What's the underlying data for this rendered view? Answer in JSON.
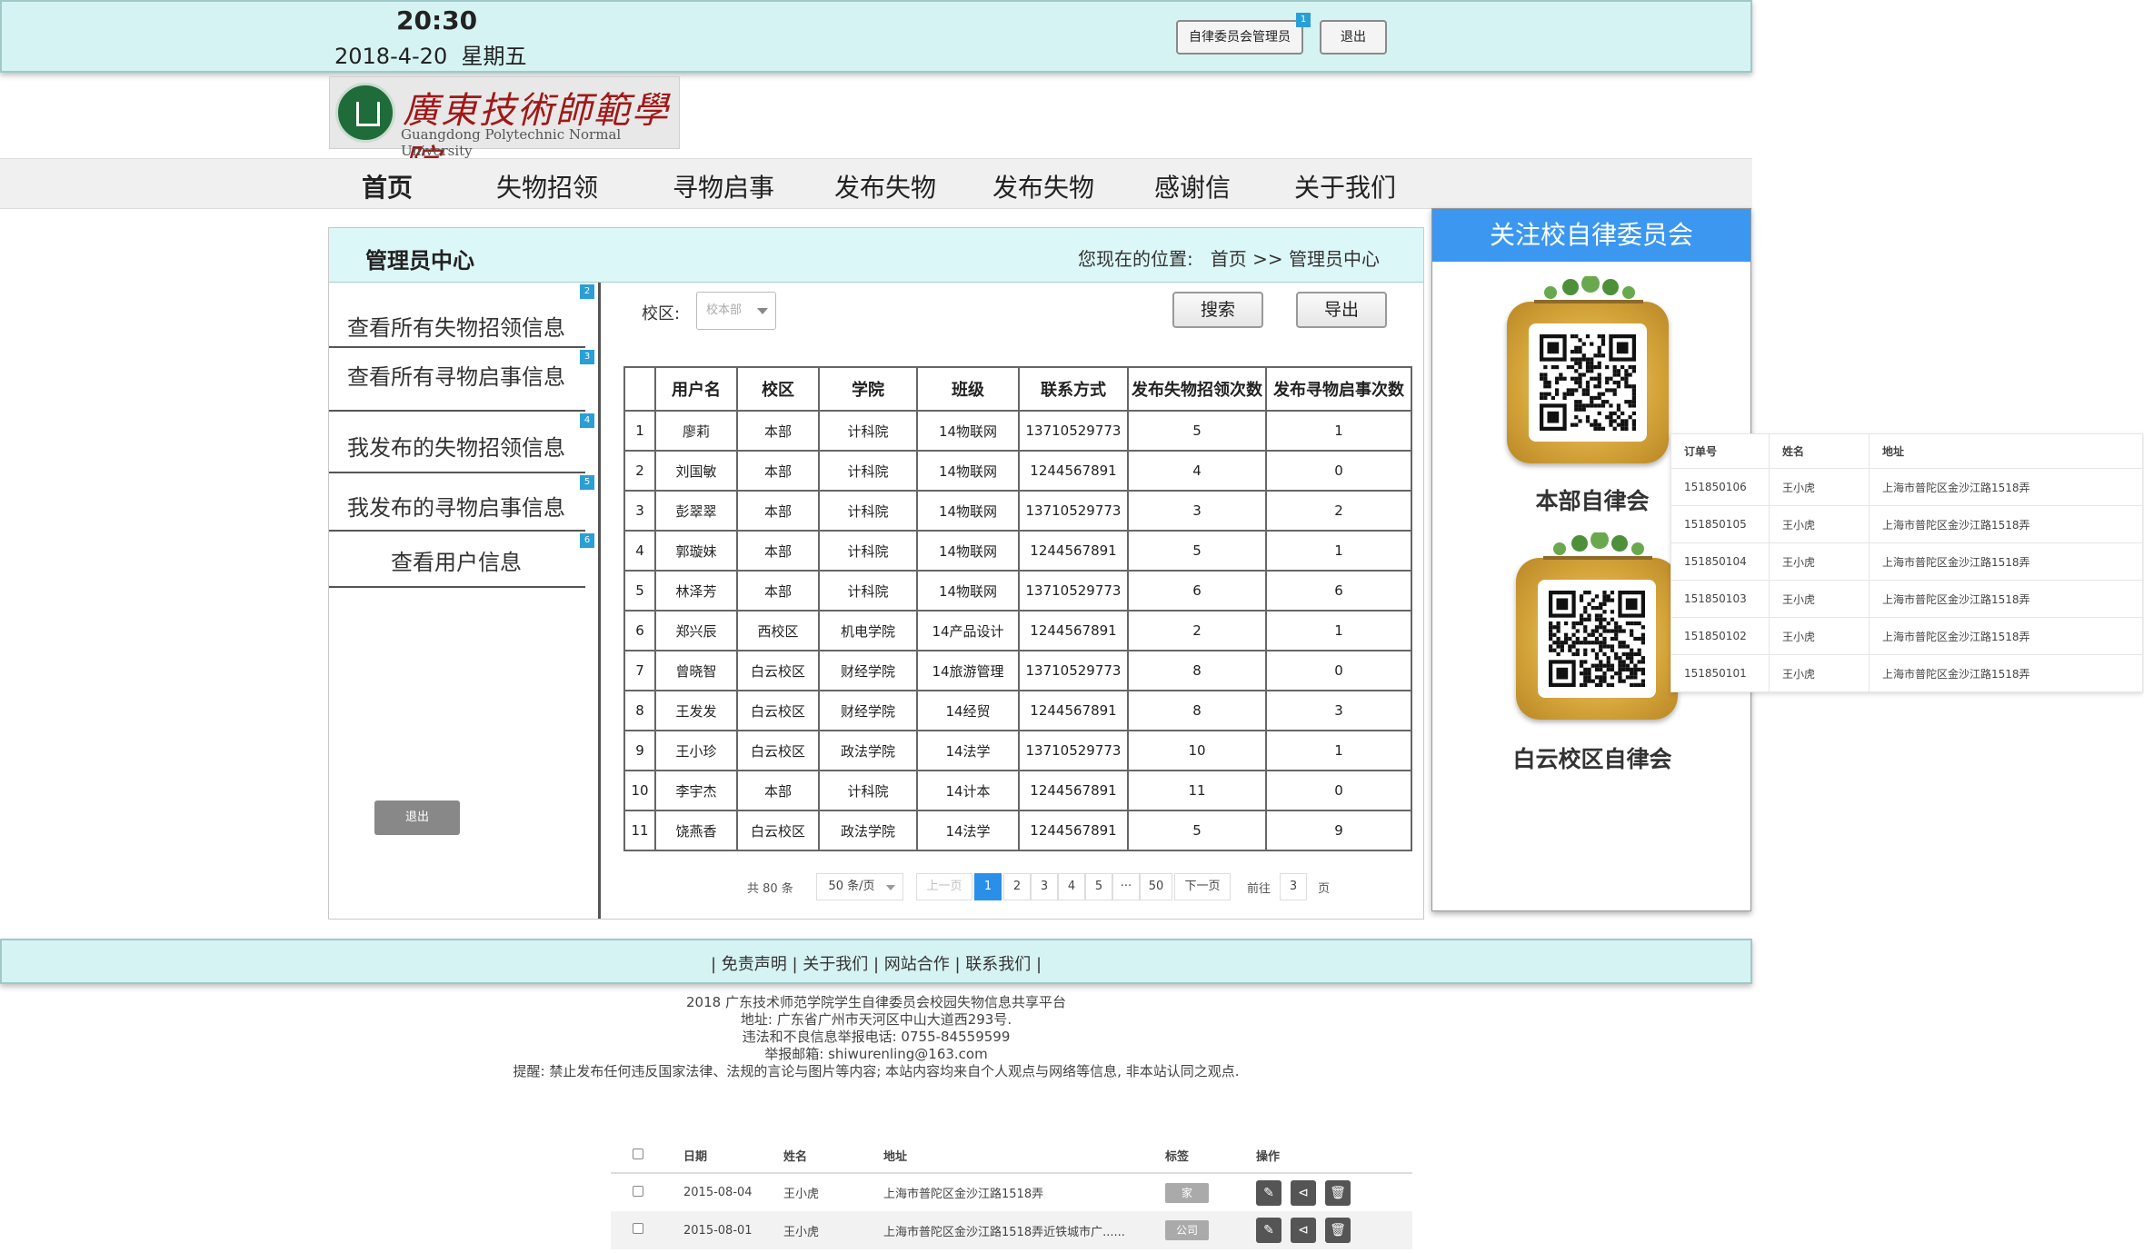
{
  "topbar": {
    "time": "20:30",
    "date": "2018-4-20  星期五",
    "admin_button": "自律委员会管理员",
    "admin_badge": "1",
    "logout_button": "退出"
  },
  "logo": {
    "cn": "廣東技術師範學院",
    "en": "Guangdong Polytechnic Normal University"
  },
  "nav": {
    "items": [
      "首页",
      "失物招领",
      "寻物启事",
      "发布失物",
      "发布失物",
      "感谢信",
      "关于我们"
    ]
  },
  "main": {
    "title": "管理员中心",
    "breadcrumb": "您现在的位置:   首页 >> 管理员中心",
    "side_menu": [
      {
        "label": "查看所有失物招领信息",
        "badge": "2"
      },
      {
        "label": "查看所有寻物启事信息",
        "badge": "3"
      },
      {
        "label": "我发布的失物招领信息",
        "badge": "4"
      },
      {
        "label": "我发布的寻物启事信息",
        "badge": "5"
      },
      {
        "label": "查看用户信息",
        "badge": "6"
      }
    ],
    "side_logout": "退出",
    "campus_label": "校区:",
    "campus_value": "校本部",
    "search_button": "搜索",
    "export_button": "导出",
    "table": {
      "headers": [
        "",
        "用户名",
        "校区",
        "学院",
        "班级",
        "联系方式",
        "发布失物招领次数",
        "发布寻物启事次数"
      ],
      "rows": [
        [
          "1",
          "廖莉",
          "本部",
          "计科院",
          "14物联网",
          "13710529773",
          "5",
          "1"
        ],
        [
          "2",
          "刘国敏",
          "本部",
          "计科院",
          "14物联网",
          "1244567891",
          "4",
          "0"
        ],
        [
          "3",
          "彭翠翠",
          "本部",
          "计科院",
          "14物联网",
          "13710529773",
          "3",
          "2"
        ],
        [
          "4",
          "郭璇妹",
          "本部",
          "计科院",
          "14物联网",
          "1244567891",
          "5",
          "1"
        ],
        [
          "5",
          "林泽芳",
          "本部",
          "计科院",
          "14物联网",
          "13710529773",
          "6",
          "6"
        ],
        [
          "6",
          "郑兴辰",
          "西校区",
          "机电学院",
          "14产品设计",
          "1244567891",
          "2",
          "1"
        ],
        [
          "7",
          "曾晓智",
          "白云校区",
          "财经学院",
          "14旅游管理",
          "13710529773",
          "8",
          "0"
        ],
        [
          "8",
          "王发发",
          "白云校区",
          "财经学院",
          "14经贸",
          "1244567891",
          "8",
          "3"
        ],
        [
          "9",
          "王小珍",
          "白云校区",
          "政法学院",
          "14法学",
          "13710529773",
          "10",
          "1"
        ],
        [
          "10",
          "李宇杰",
          "本部",
          "计科院",
          "14计本",
          "1244567891",
          "11",
          "0"
        ],
        [
          "11",
          "饶燕香",
          "白云校区",
          "政法学院",
          "14法学",
          "1244567891",
          "5",
          "9"
        ]
      ]
    },
    "pager": {
      "total": "共 80 条",
      "per_page": "50 条/页",
      "prev": "上一页",
      "pages": [
        "1",
        "2",
        "3",
        "4",
        "5",
        "···",
        "50"
      ],
      "next": "下一页",
      "goto_prefix": "前往",
      "goto_value": "3",
      "goto_suffix": "页"
    }
  },
  "right": {
    "title": "关注校自律委员会",
    "qr1_label": "本部自律会",
    "qr2_label": "白云校区自律会"
  },
  "order_table": {
    "headers": [
      "订单号",
      "姓名",
      "地址"
    ],
    "rows": [
      [
        "151850106",
        "王小虎",
        "上海市普陀区金沙江路1518弄"
      ],
      [
        "151850105",
        "王小虎",
        "上海市普陀区金沙江路1518弄"
      ],
      [
        "151850104",
        "王小虎",
        "上海市普陀区金沙江路1518弄"
      ],
      [
        "151850103",
        "王小虎",
        "上海市普陀区金沙江路1518弄"
      ],
      [
        "151850102",
        "王小虎",
        "上海市普陀区金沙江路1518弄"
      ],
      [
        "151850101",
        "王小虎",
        "上海市普陀区金沙江路1518弄"
      ]
    ]
  },
  "footer": {
    "links": "| 免责声明 | 关于我们 | 网站合作 | 联系我们 |",
    "lines": [
      "2018 广东技术师范学院学生自律委员会校园失物信息共享平台",
      "地址:  广东省广州市天河区中山大道西293号.",
      "违法和不良信息举报电话:  0755-84559599",
      "举报邮箱:  shiwurenling@163.com",
      "提醒:  禁止发布任何违反国家法律、法规的言论与图片等内容;  本站内容均来自个人观点与网络等信息,  非本站认同之观点."
    ]
  },
  "bottom_table": {
    "headers": [
      "",
      "日期",
      "姓名",
      "地址",
      "标签",
      "操作"
    ],
    "rows": [
      [
        "2015-08-04",
        "王小虎",
        "上海市普陀区金沙江路1518弄",
        "家"
      ],
      [
        "2015-08-01",
        "王小虎",
        "上海市普陀区金沙江路1518弄近铁城市广......",
        "公司"
      ]
    ]
  }
}
